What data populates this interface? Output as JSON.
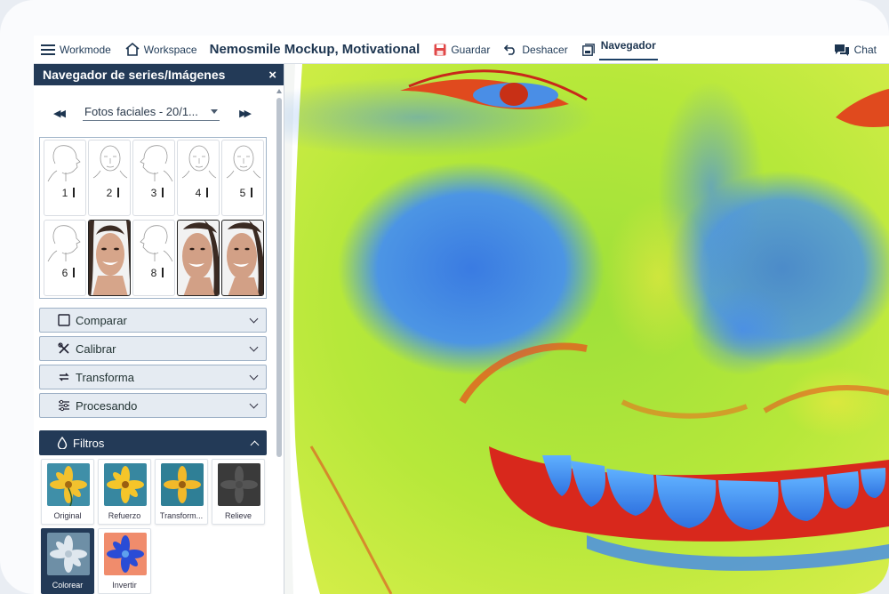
{
  "topbar": {
    "workmode_label": "Workmode",
    "workspace_label": "Workspace",
    "title": "Nemosmile Mockup, Motivational",
    "guardar_label": "Guardar",
    "deshacer_label": "Deshacer",
    "navegador_label": "Navegador",
    "chat_label": "Chat"
  },
  "panel": {
    "title": "Navegador de series/Imágenes",
    "close": "×",
    "series_selected": "Fotos faciales - 20/1...",
    "prev_icon": "skip-back-icon",
    "next_icon": "skip-forward-icon"
  },
  "thumbnails": [
    {
      "label": "1",
      "kind": "sketch-profile-right"
    },
    {
      "label": "2",
      "kind": "sketch-frontal"
    },
    {
      "label": "3",
      "kind": "sketch-profile-left"
    },
    {
      "label": "4",
      "kind": "sketch-frontal"
    },
    {
      "label": "5",
      "kind": "sketch-frontal"
    },
    {
      "label": "6",
      "kind": "sketch-profile-right"
    },
    {
      "label": "",
      "kind": "photo-frontal-smile"
    },
    {
      "label": "8",
      "kind": "sketch-profile-left"
    },
    {
      "label": "",
      "kind": "photo-three-quarter"
    },
    {
      "label": "",
      "kind": "photo-three-quarter"
    }
  ],
  "sections": [
    {
      "label": "Comparar",
      "icon": "checkbox-icon"
    },
    {
      "label": "Calibrar",
      "icon": "tools-icon"
    },
    {
      "label": "Transforma",
      "icon": "swap-icon"
    },
    {
      "label": "Procesando",
      "icon": "sliders-icon"
    }
  ],
  "filters_section": {
    "label": "Filtros",
    "icon": "drop-icon"
  },
  "filters": [
    {
      "label": "Original",
      "selected": false
    },
    {
      "label": "Refuerzo",
      "selected": false
    },
    {
      "label": "Transform...",
      "selected": false
    },
    {
      "label": "Relieve",
      "selected": false
    },
    {
      "label": "Colorear",
      "selected": true
    },
    {
      "label": "Invertir",
      "selected": false
    }
  ],
  "colors": {
    "navy": "#233a57",
    "accent_red": "#e04848",
    "heatmap_blue": "#3c7fe0",
    "heatmap_green": "#9ee03a",
    "heatmap_yellow": "#f2e23a",
    "heatmap_red": "#d8281c"
  }
}
